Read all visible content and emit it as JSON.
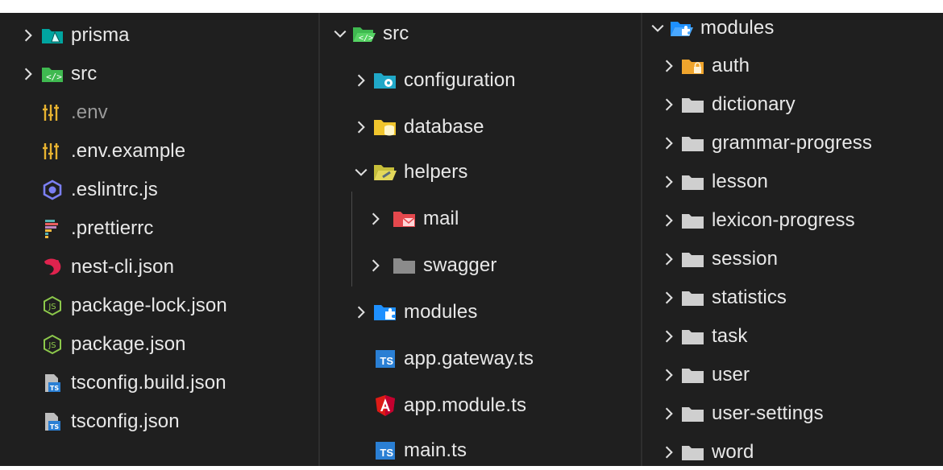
{
  "panel1": {
    "items": [
      {
        "label": "prisma",
        "icon": "folder-prisma-icon",
        "expandable": true
      },
      {
        "label": "src",
        "icon": "folder-src-icon",
        "expandable": true
      },
      {
        "label": ".env",
        "icon": "env-settings-icon",
        "expandable": false,
        "dim": true
      },
      {
        "label": ".env.example",
        "icon": "env-settings-icon",
        "expandable": false
      },
      {
        "label": ".eslintrc.js",
        "icon": "eslint-icon",
        "expandable": false
      },
      {
        "label": ".prettierrc",
        "icon": "prettier-icon",
        "expandable": false
      },
      {
        "label": "nest-cli.json",
        "icon": "nestjs-icon",
        "expandable": false
      },
      {
        "label": "package-lock.json",
        "icon": "nodejs-icon",
        "expandable": false
      },
      {
        "label": "package.json",
        "icon": "nodejs-icon",
        "expandable": false
      },
      {
        "label": "tsconfig.build.json",
        "icon": "tsconfig-icon",
        "expandable": false
      },
      {
        "label": "tsconfig.json",
        "icon": "tsconfig-icon",
        "expandable": false
      }
    ]
  },
  "panel2": {
    "root": {
      "label": "src",
      "icon": "folder-src-open-icon",
      "expanded": true
    },
    "items": [
      {
        "label": "configuration",
        "icon": "folder-config-icon",
        "expandable": true
      },
      {
        "label": "database",
        "icon": "folder-database-icon",
        "expandable": true
      },
      {
        "label": "helpers",
        "icon": "folder-helper-open-icon",
        "expandable": true,
        "expanded": true
      },
      {
        "label": "mail",
        "icon": "folder-mail-icon",
        "expandable": true,
        "nested": true
      },
      {
        "label": "swagger",
        "icon": "folder-gray-icon",
        "expandable": true,
        "nested": true
      },
      {
        "label": "modules",
        "icon": "folder-modules-icon",
        "expandable": true
      },
      {
        "label": "app.gateway.ts",
        "icon": "typescript-icon",
        "expandable": false
      },
      {
        "label": "app.module.ts",
        "icon": "angular-icon",
        "expandable": false
      },
      {
        "label": "main.ts",
        "icon": "typescript-icon",
        "expandable": false
      }
    ],
    "ts_text": "TS"
  },
  "panel3": {
    "root": {
      "label": "modules",
      "icon": "folder-modules-open-icon",
      "expanded": true
    },
    "items": [
      {
        "label": "auth",
        "icon": "folder-auth-icon"
      },
      {
        "label": "dictionary",
        "icon": "folder-icon"
      },
      {
        "label": "grammar-progress",
        "icon": "folder-icon"
      },
      {
        "label": "lesson",
        "icon": "folder-icon"
      },
      {
        "label": "lexicon-progress",
        "icon": "folder-icon"
      },
      {
        "label": "session",
        "icon": "folder-icon"
      },
      {
        "label": "statistics",
        "icon": "folder-icon"
      },
      {
        "label": "task",
        "icon": "folder-icon"
      },
      {
        "label": "user",
        "icon": "folder-icon"
      },
      {
        "label": "user-settings",
        "icon": "folder-icon"
      },
      {
        "label": "word",
        "icon": "folder-icon"
      }
    ]
  }
}
